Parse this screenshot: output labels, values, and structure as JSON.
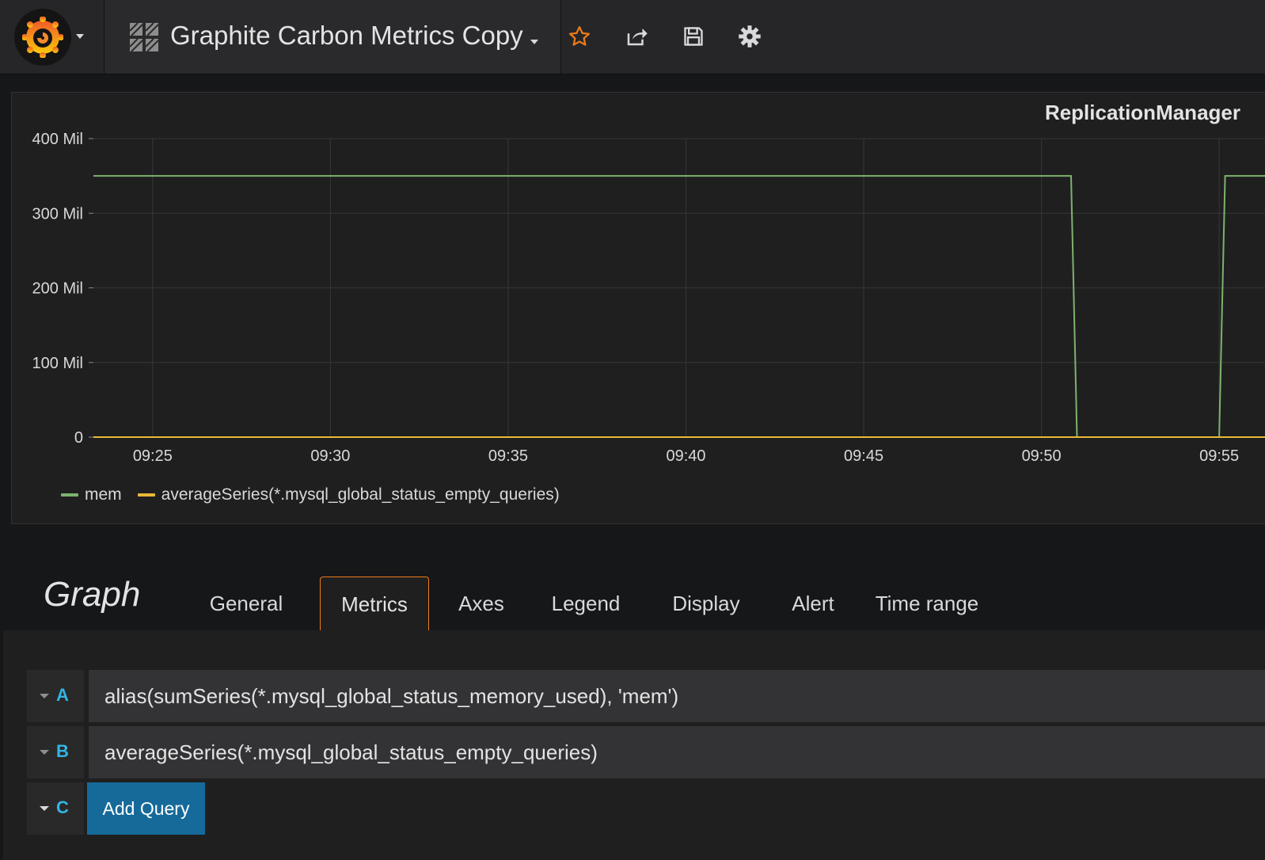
{
  "nav": {
    "dashboard_title": "Graphite Carbon Metrics Copy",
    "icons": [
      "grafana-logo-icon",
      "dashboard-grid-icon",
      "star-icon",
      "share-icon",
      "save-icon",
      "settings-gear-icon"
    ],
    "colors": {
      "star": "#eb7b18",
      "logo": "#f05a28"
    }
  },
  "panel": {
    "title": "ReplicationManager"
  },
  "chart_data": {
    "type": "line",
    "title": "ReplicationManager",
    "xlabel": "",
    "ylabel": "",
    "y_tick_labels": [
      "0",
      "100 Mil",
      "200 Mil",
      "300 Mil",
      "400 Mil"
    ],
    "y_ticks": [
      0,
      100000000,
      200000000,
      300000000,
      400000000
    ],
    "x_tick_labels": [
      "09:25",
      "09:30",
      "09:35",
      "09:40",
      "09:45",
      "09:50",
      "09:55"
    ],
    "ylim": [
      0,
      400000000
    ],
    "xlim": [
      "09:23:20",
      "09:56:40"
    ],
    "grid": true,
    "legend_position": "bottom-left",
    "series": [
      {
        "name": "mem",
        "color": "#7eb26d",
        "points": [
          [
            "09:23:20",
            350000000
          ],
          [
            "09:50:50",
            350000000
          ],
          [
            "09:51:00",
            0
          ],
          [
            "09:55:00",
            0
          ],
          [
            "09:55:10",
            350000000
          ],
          [
            "09:56:40",
            350000000
          ]
        ]
      },
      {
        "name": "averageSeries(*.mysql_global_status_empty_queries)",
        "color": "#eab839",
        "points": [
          [
            "09:23:20",
            0
          ],
          [
            "09:56:40",
            0
          ]
        ]
      }
    ]
  },
  "editor": {
    "title": "Graph",
    "tabs": [
      "General",
      "Metrics",
      "Axes",
      "Legend",
      "Display",
      "Alert",
      "Time range"
    ],
    "active_tab": "Metrics",
    "queries": [
      {
        "ref": "A",
        "target": "alias(sumSeries(*.mysql_global_status_memory_used), 'mem')"
      },
      {
        "ref": "B",
        "target": "averageSeries(*.mysql_global_status_empty_queries)"
      }
    ],
    "next_ref": "C",
    "add_query_label": "Add Query"
  }
}
